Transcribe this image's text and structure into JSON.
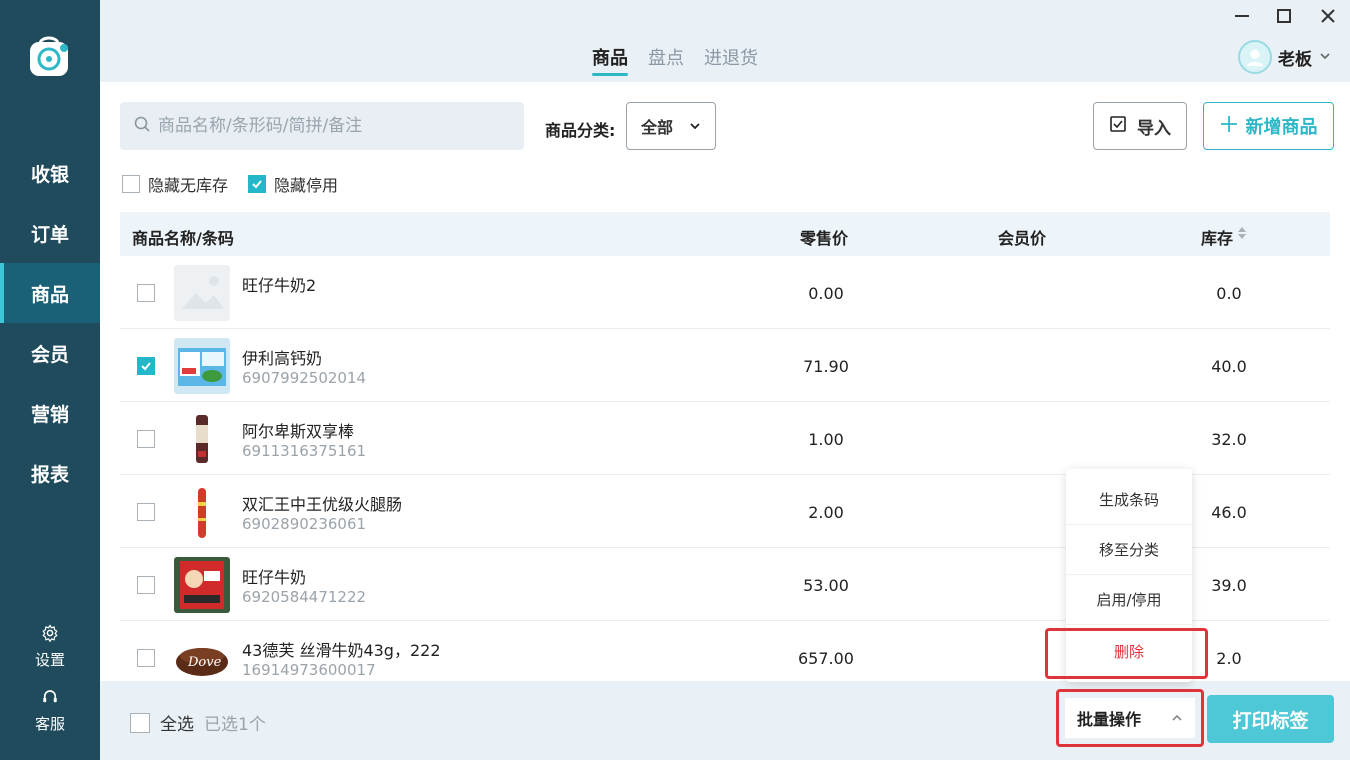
{
  "sidebar": {
    "items": [
      {
        "label": "收银",
        "active": false
      },
      {
        "label": "订单",
        "active": false
      },
      {
        "label": "商品",
        "active": true
      },
      {
        "label": "会员",
        "active": false
      },
      {
        "label": "营销",
        "active": false
      },
      {
        "label": "报表",
        "active": false
      }
    ],
    "settings_label": "设置",
    "service_label": "客服"
  },
  "header": {
    "tabs": [
      {
        "label": "商品",
        "active": true
      },
      {
        "label": "盘点",
        "active": false
      },
      {
        "label": "进退货",
        "active": false
      }
    ],
    "user_name": "老板"
  },
  "toolbar": {
    "search_placeholder": "商品名称/条形码/简拼/备注",
    "category_label": "商品分类:",
    "category_value": "全部",
    "import_label": "导入",
    "add_label": "新增商品"
  },
  "filters": {
    "hide_no_stock": {
      "label": "隐藏无库存",
      "checked": false
    },
    "hide_disabled": {
      "label": "隐藏停用",
      "checked": true
    }
  },
  "table": {
    "columns": {
      "name": "商品名称/条码",
      "retail": "零售价",
      "member": "会员价",
      "stock": "库存"
    },
    "rows": [
      {
        "name": "旺仔牛奶2",
        "code": "",
        "retail": "0.00",
        "member": "",
        "stock": "0.0",
        "checked": false,
        "thumb": "placeholder-image"
      },
      {
        "name": "伊利高钙奶",
        "code": "6907992502014",
        "retail": "71.90",
        "member": "",
        "stock": "40.0",
        "checked": true,
        "thumb": "milk-box-image"
      },
      {
        "name": "阿尔卑斯双享棒",
        "code": "6911316375161",
        "retail": "1.00",
        "member": "",
        "stock": "32.0",
        "checked": false,
        "thumb": "candy-stick-image"
      },
      {
        "name": "双汇王中王优级火腿肠",
        "code": "6902890236061",
        "retail": "2.00",
        "member": "",
        "stock": "46.0",
        "checked": false,
        "thumb": "sausage-image"
      },
      {
        "name": "旺仔牛奶",
        "code": "6920584471222",
        "retail": "53.00",
        "member": "",
        "stock": "39.0",
        "checked": false,
        "thumb": "wangzai-milk-image"
      },
      {
        "name": "43德芙 丝滑牛奶43g，222",
        "code": "16914973600017",
        "retail": "657.00",
        "member": "",
        "stock": "2.0",
        "checked": false,
        "thumb": "dove-chocolate-image"
      }
    ]
  },
  "footer": {
    "select_all_label": "全选",
    "selected_count_text": "已选1个",
    "batch_label": "批量操作",
    "print_label": "打印标签"
  },
  "batch_menu": {
    "items": [
      "生成条码",
      "移至分类",
      "启用/停用",
      "删除"
    ]
  },
  "colors": {
    "sidebar": "#1f4b5c",
    "accent": "#2eb8c7",
    "danger": "#e0343b"
  }
}
